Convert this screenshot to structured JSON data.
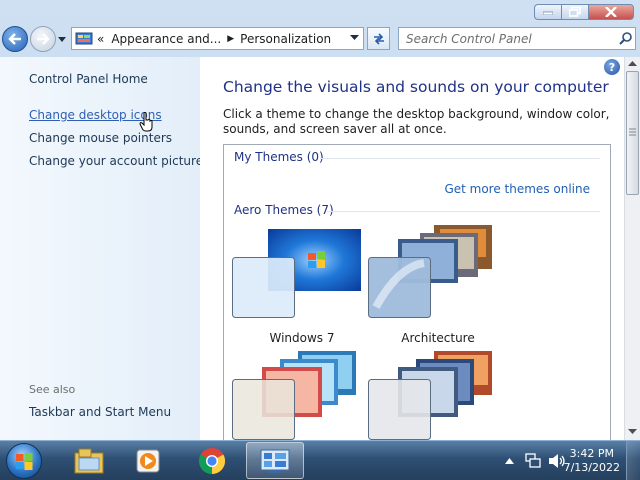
{
  "window": {
    "caption_buttons": [
      "minimize-icon",
      "maximize-icon",
      "close-icon"
    ]
  },
  "navigation": {
    "breadcrumb": {
      "overflow": "«",
      "items": [
        "Appearance and...",
        "Personalization"
      ]
    },
    "search": {
      "placeholder": "Search Control Panel"
    }
  },
  "sidebar": {
    "home": "Control Panel Home",
    "links": [
      "Change desktop icons",
      "Change mouse pointers",
      "Change your account picture"
    ],
    "see_also_header": "See also",
    "see_also_links": [
      "Taskbar and Start Menu"
    ]
  },
  "main": {
    "help": "?",
    "title": "Change the visuals and sounds on your computer",
    "description": "Click a theme to change the desktop background, window color, sounds, and screen saver all at once.",
    "my_themes": "My Themes (0)",
    "get_more": "Get more themes online",
    "aero_themes": "Aero Themes (7)",
    "themes": [
      {
        "name": "Windows 7"
      },
      {
        "name": "Architecture"
      },
      {
        "name": ""
      },
      {
        "name": ""
      }
    ]
  },
  "taskbar": {
    "pinned": [
      "explorer-icon",
      "media-player-icon",
      "chrome-icon",
      "control-panel-icon"
    ],
    "active_index": 3,
    "clock": {
      "time": "3:42 PM",
      "date": "7/13/2022"
    }
  }
}
